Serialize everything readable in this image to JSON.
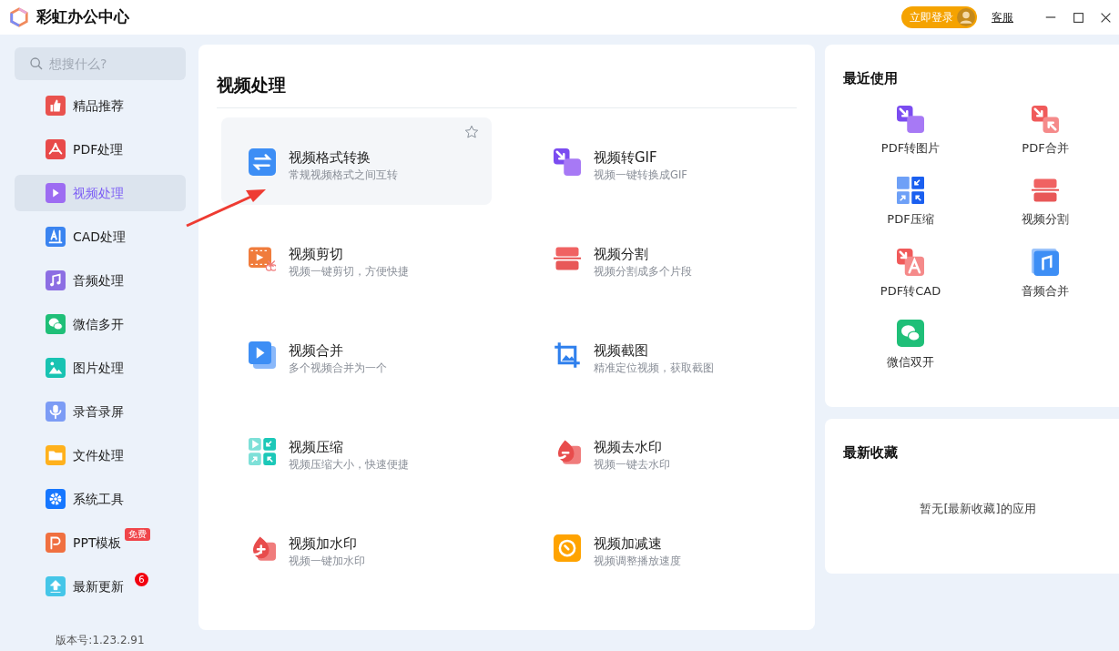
{
  "window": {
    "title": "彩虹办公中心",
    "login_button": "立即登录",
    "support_link": "客服"
  },
  "sidebar": {
    "search": {
      "placeholder": "想搜什么?"
    },
    "items": [
      {
        "label": "精品推荐",
        "selected": false
      },
      {
        "label": "PDF处理",
        "selected": false
      },
      {
        "label": "视频处理",
        "selected": true
      },
      {
        "label": "CAD处理",
        "selected": false
      },
      {
        "label": "音频处理",
        "selected": false
      },
      {
        "label": "微信多开",
        "selected": false
      },
      {
        "label": "图片处理",
        "selected": false
      },
      {
        "label": "录音录屏",
        "selected": false
      },
      {
        "label": "文件处理",
        "selected": false
      },
      {
        "label": "系统工具",
        "selected": false
      },
      {
        "label": "PPT模板",
        "selected": false,
        "tag": "免费"
      },
      {
        "label": "最新更新",
        "selected": false,
        "count": "6"
      }
    ],
    "version": "版本号:1.23.2.91"
  },
  "main": {
    "title": "视频处理",
    "tools": [
      {
        "title": "视频格式转换",
        "description": "常规视频格式之间互转",
        "selected": true
      },
      {
        "title": "视频转GIF",
        "description": "视频一键转换成GIF",
        "selected": false
      },
      {
        "title": "视频剪切",
        "description": "视频一键剪切，方便快捷",
        "selected": false
      },
      {
        "title": "视频分割",
        "description": "视频分割成多个片段",
        "selected": false
      },
      {
        "title": "视频合并",
        "description": "多个视频合并为一个",
        "selected": false
      },
      {
        "title": "视频截图",
        "description": "精准定位视频，获取截图",
        "selected": false
      },
      {
        "title": "视频压缩",
        "description": "视频压缩大小，快速便捷",
        "selected": false
      },
      {
        "title": "视频去水印",
        "description": "视频一键去水印",
        "selected": false
      },
      {
        "title": "视频加水印",
        "description": "视频一键加水印",
        "selected": false
      },
      {
        "title": "视频加减速",
        "description": "视频调整播放速度",
        "selected": false
      }
    ]
  },
  "recent": {
    "title": "最近使用",
    "items": [
      {
        "label": "PDF转图片"
      },
      {
        "label": "PDF合并"
      },
      {
        "label": "PDF压缩"
      },
      {
        "label": "视频分割"
      },
      {
        "label": "PDF转CAD"
      },
      {
        "label": "音频合并"
      },
      {
        "label": "微信双开"
      }
    ]
  },
  "favorites": {
    "title": "最新收藏",
    "empty_message": "暂无[最新收藏]的应用"
  }
}
